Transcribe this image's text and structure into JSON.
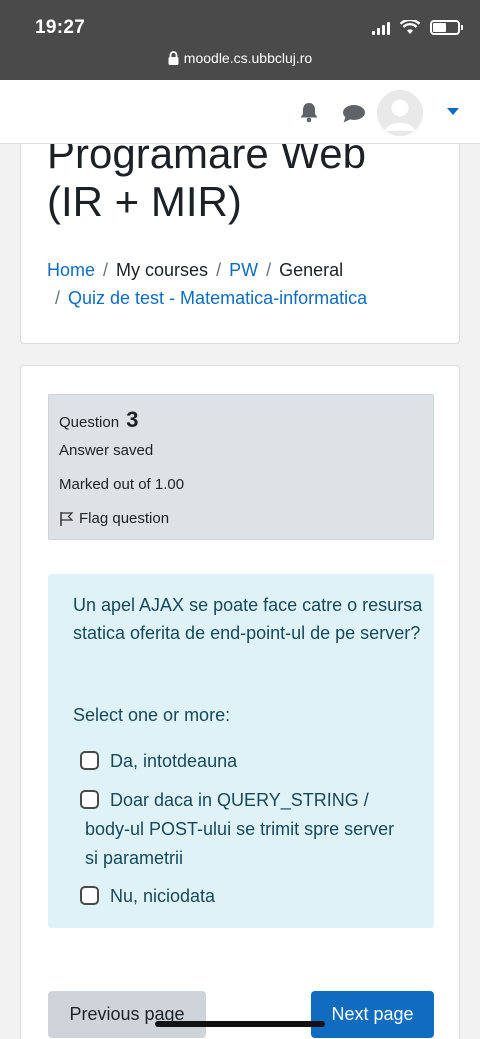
{
  "status_bar": {
    "time": "19:27",
    "url": "moodle.cs.ubbcluj.ro"
  },
  "navbar": {
    "icons": [
      "bell-icon",
      "chat-icon",
      "avatar",
      "caret-down-icon"
    ],
    "accent_color": "#0f6cbf"
  },
  "course": {
    "title_line1": "Programare Web",
    "title_line2": "(IR + MIR)"
  },
  "breadcrumb": {
    "items": [
      {
        "label": "Home",
        "link": true
      },
      {
        "label": "My courses",
        "link": false
      },
      {
        "label": "PW",
        "link": true
      },
      {
        "label": "General",
        "link": false
      },
      {
        "label": "Quiz de test - Matematica-informatica",
        "link": true
      }
    ]
  },
  "question_info": {
    "question_label": "Question",
    "question_number": "3",
    "state": "Answer saved",
    "marked": "Marked out of 1.00",
    "flag_label": "Flag question"
  },
  "question": {
    "prompt": "Un apel AJAX se poate face catre o resursa statica oferita de end-point-ul de pe server?",
    "select_label": "Select one or more:",
    "options": [
      {
        "label": "Da, intotdeauna",
        "checked": false
      },
      {
        "label": "Doar daca in QUERY_STRING / body-ul POST-ului se trimit spre server si parametrii",
        "label_line1": "Doar daca in QUERY_STRING /",
        "label_line2": "body-ul POST-ului se trimit spre server si parametrii",
        "checked": false
      },
      {
        "label": "Nu, niciodata",
        "checked": false
      }
    ]
  },
  "navigation": {
    "prev_label": "Previous page",
    "next_label": "Next page"
  }
}
